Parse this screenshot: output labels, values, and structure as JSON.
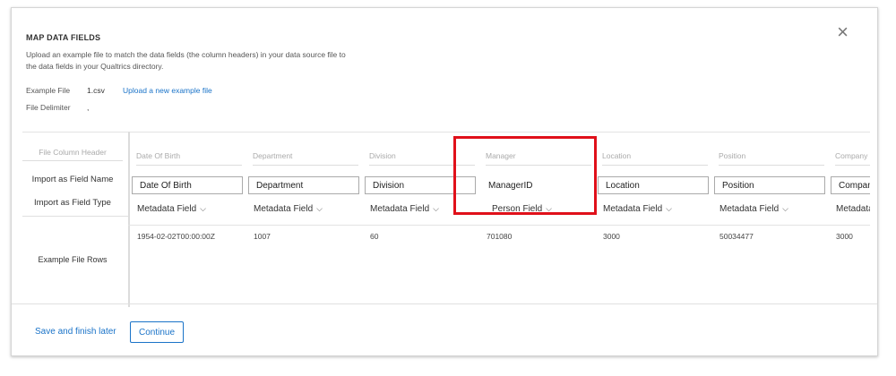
{
  "modal": {
    "title": "MAP DATA FIELDS",
    "description": "Upload an example file to match the data fields (the column headers) in your data source file to the data fields in your Qualtrics directory.",
    "close_symbol": "×",
    "example_file_label": "Example File",
    "example_file_value": "1.csv",
    "upload_link": "Upload a new example file",
    "delimiter_label": "File Delimiter",
    "delimiter_value": ","
  },
  "row_labels": {
    "file_column_header": "File Column Header",
    "import_as_field_name": "Import as Field Name",
    "import_as_field_type": "Import as Field Type",
    "example_file_rows": "Example File Rows"
  },
  "columns": [
    {
      "header": "Date Of Birth",
      "field_name": "Date Of Birth",
      "field_type": "Metadata Field",
      "example": "1954-02-02T00:00:00Z"
    },
    {
      "header": "Department",
      "field_name": "Department",
      "field_type": "Metadata Field",
      "example": "1007"
    },
    {
      "header": "Division",
      "field_name": "Division",
      "field_type": "Metadata Field",
      "example": "60"
    },
    {
      "header": "Manager",
      "field_name": "ManagerID",
      "field_type": "Person Field",
      "example": "701080"
    },
    {
      "header": "Location",
      "field_name": "Location",
      "field_type": "Metadata Field",
      "example": "3000"
    },
    {
      "header": "Position",
      "field_name": "Position",
      "field_type": "Metadata Field",
      "example": "50034477"
    },
    {
      "header": "Company",
      "field_name": "Company",
      "field_type": "Metadata Field",
      "example": "3000"
    }
  ],
  "footer": {
    "save_later": "Save and finish later",
    "continue": "Continue"
  },
  "colors": {
    "accent": "#1a73c8",
    "highlight": "#e0101a"
  }
}
